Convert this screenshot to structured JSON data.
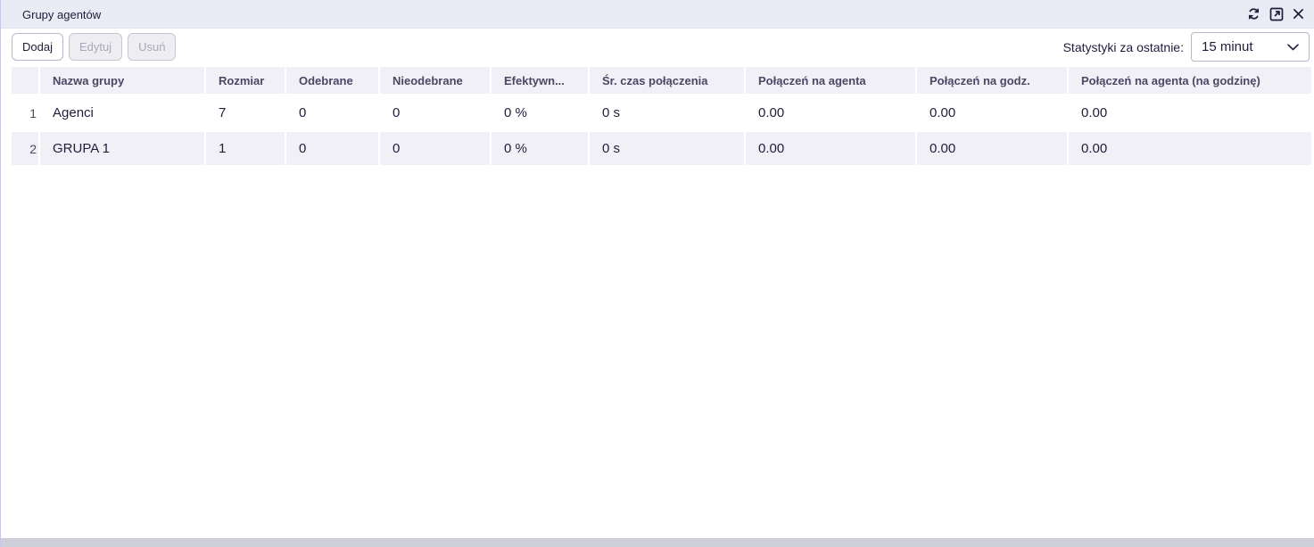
{
  "window": {
    "title": "Grupy agentów"
  },
  "toolbar": {
    "add_label": "Dodaj",
    "edit_label": "Edytuj",
    "delete_label": "Usuń"
  },
  "stats": {
    "label": "Statystyki za ostatnie:",
    "selected": "15 minut"
  },
  "table": {
    "columns": [
      "Nazwa grupy",
      "Rozmiar",
      "Odebrane",
      "Nieodebrane",
      "Efektywn...",
      "Śr. czas połączenia",
      "Połączeń na agenta",
      "Połączeń na godz.",
      "Połączeń na agenta (na godzinę)"
    ],
    "rows": [
      {
        "index": "1",
        "cells": [
          "Agenci",
          "7",
          "0",
          "0",
          "0 %",
          "0 s",
          "0.00",
          "0.00",
          "0.00"
        ]
      },
      {
        "index": "2",
        "cells": [
          "GRUPA 1",
          "1",
          "0",
          "0",
          "0 %",
          "0 s",
          "0.00",
          "0.00",
          "0.00"
        ]
      }
    ]
  }
}
